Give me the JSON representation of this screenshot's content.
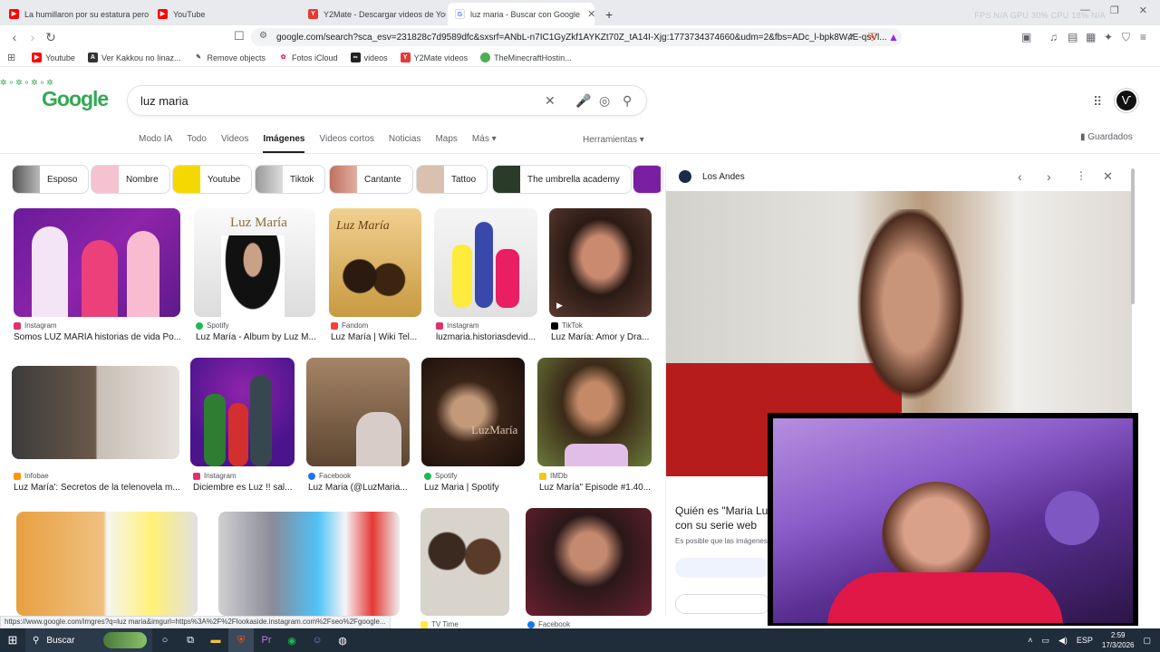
{
  "browser": {
    "tabs": [
      {
        "title": "La humillaron por su estatura pero n",
        "color": "#ff0000",
        "active": false
      },
      {
        "title": "YouTube",
        "color": "#ff0000",
        "active": false
      },
      {
        "title": "Y2Mate - Descargar videos de YouTu",
        "color": "#e53935",
        "active": false
      },
      {
        "title": "luz maria - Buscar con Google",
        "color": "#4285f4",
        "active": true
      }
    ],
    "new_tab": "+",
    "stats": "FPS N/A   GPU 30%   CPU 18%   N/A",
    "url": "google.com/search?sca_esv=231828c7d9589dfc&sxsrf=ANbL-n7IC1GyZkf1AYKZt70Z_tA14I-Xjg:1773734374660&udm=2&fbs=ADc_l-bpk8W4E-qsVl...",
    "bookmarks": [
      {
        "label": "Youtube",
        "color": "#ff0000"
      },
      {
        "label": "Ver Kakkou no Iinaz...",
        "color": "#333333"
      },
      {
        "label": "Remove objects",
        "color": "#555555"
      },
      {
        "label": "Fotos iCloud",
        "color": "#e91e63"
      },
      {
        "label": "videos",
        "color": "#222222"
      },
      {
        "label": "Y2Mate videos",
        "color": "#e53935"
      },
      {
        "label": "TheMinecraftHostin...",
        "color": "#4caf50"
      }
    ]
  },
  "google": {
    "logo": "Google",
    "query": "luz maria",
    "nav": [
      "Modo IA",
      "Todo",
      "Videos",
      "Imágenes",
      "Videos cortos",
      "Noticias",
      "Maps",
      "Más ▾"
    ],
    "active_nav": "Imágenes",
    "tools": "Herramientas ▾",
    "saved": "Guardados",
    "chips": [
      "Esposo",
      "Nombre",
      "Youtube",
      "Tiktok",
      "Cantante",
      "Tattoo",
      "The umbrella academy"
    ],
    "results": [
      {
        "source": "Instagram",
        "caption": "Somos LUZ MARÍA historias de vida Po..."
      },
      {
        "source": "Spotify",
        "caption": "Luz María - Album by Luz M..."
      },
      {
        "source": "Fandom",
        "caption": "Luz María | Wiki Tel..."
      },
      {
        "source": "Instagram",
        "caption": "luzmaria.historiasdevid..."
      },
      {
        "source": "TikTok",
        "caption": "Luz María: Amor y Dra..."
      },
      {
        "source": "Infobae",
        "caption": "Luz María': Secretos de la telenovela m..."
      },
      {
        "source": "Instagram",
        "caption": "Diciembre es Luz !! sal..."
      },
      {
        "source": "Facebook",
        "caption": "Luz Maria (@LuzMaria..."
      },
      {
        "source": "Spotify",
        "caption": "Luz Maria | Spotify"
      },
      {
        "source": "IMDb",
        "caption": "Luz María\" Episode #1.40..."
      },
      {
        "source": "",
        "caption": ""
      },
      {
        "source": "",
        "caption": ""
      },
      {
        "source": "TV Time",
        "caption": ""
      },
      {
        "source": "Facebook",
        "caption": ""
      }
    ],
    "thumb_text": {
      "spotify": "Luz María",
      "fandom": "Luz María",
      "spotify2": "LuzMaría"
    },
    "status_url": "https://www.google.com/imgres?q=luz maria&imgurl=https%3A%2F%2Flookaside.instagram.com%2Fseo%2Fgoogle..."
  },
  "panel": {
    "source": "Los Andes",
    "title": "Quién es \"Maria Lu con su serie web",
    "subtitle": "Es posible que las imágenes"
  },
  "taskbar": {
    "search": "Buscar",
    "lang": "ESP",
    "time": "2:59",
    "date": "17/3/2026"
  }
}
